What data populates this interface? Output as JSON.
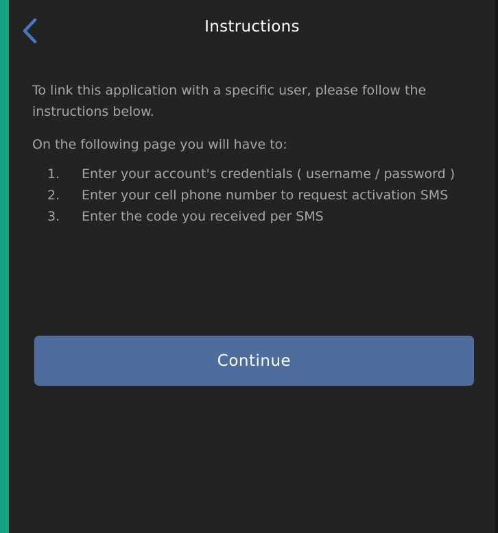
{
  "header": {
    "title": "Instructions",
    "back_icon": "chevron-left-icon"
  },
  "content": {
    "intro": "To link this application with a specific user, please follow the instructions below.",
    "lead": "On the following page you will have to:",
    "steps": [
      {
        "number": "1.",
        "text": "Enter your account's credentials ( username / password )"
      },
      {
        "number": "2.",
        "text": "Enter your cell phone number to request activation SMS"
      },
      {
        "number": "3.",
        "text": "Enter the code you received per SMS"
      }
    ]
  },
  "actions": {
    "continue_label": "Continue"
  },
  "colors": {
    "background": "#232323",
    "accent_edge": "#14a37f",
    "button": "#4e6c9c",
    "back_icon": "#4a78c0",
    "body_text": "#a6a6a6",
    "title_text": "#ffffff"
  }
}
